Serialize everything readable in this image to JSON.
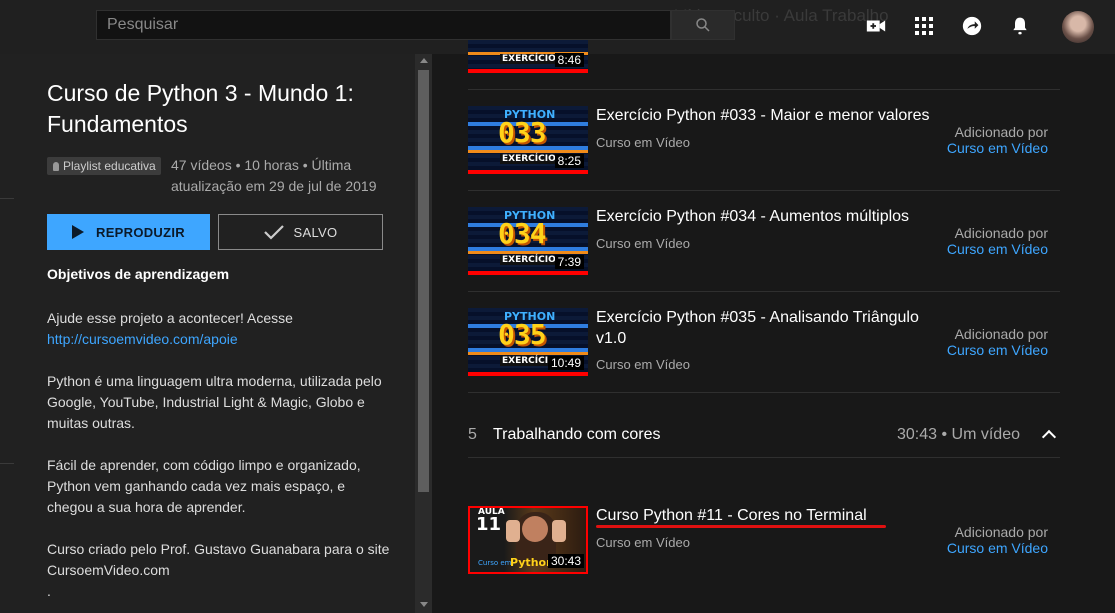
{
  "header": {
    "search_placeholder": "Pesquisar",
    "background_ghost_text": "Vídeo oculto · Aula Trabalho"
  },
  "playlist": {
    "title": "Curso de Python 3 - Mundo 1: Fundamentos",
    "badge": "Playlist educativa",
    "stats": "47 vídeos • 10 horas • Última atualização em 29 de jul de 2019",
    "play_label": "REPRODUZIR",
    "saved_label": "SALVO",
    "objectives_heading": "Objetivos de aprendizagem",
    "desc1_text": "Ajude esse projeto a acontecer! Acesse",
    "desc1_link": "http://cursoemvideo.com/apoie",
    "desc2": "Python é uma linguagem ultra moderna, utilizada pelo Google, YouTube, Industrial Light & Magic, Globo e muitas outras.",
    "desc3": "Fácil de aprender, com código limpo e organizado, Python vem ganhando cada vez mais espaço, e chegou a sua hora de aprender.",
    "desc4": "Curso criado pelo Prof. Gustavo Guanabara para o site CursoemVideo.com",
    "desc5": "."
  },
  "videos": [
    {
      "thumb_label": "EXERCÍCIO",
      "duration": "8:46"
    },
    {
      "title": "Exercício Python #033 - Maior e menor valores",
      "channel": "Curso em Vídeo",
      "thumb_label": "EXERCÍCIO",
      "thumb_python": "PYTHON",
      "thumb_number": "033",
      "duration": "8:25",
      "added_label": "Adicionado por",
      "added_channel": "Curso em Vídeo"
    },
    {
      "title": "Exercício Python #034 - Aumentos múltiplos",
      "channel": "Curso em Vídeo",
      "thumb_label": "EXERCÍCIO",
      "thumb_python": "PYTHON",
      "thumb_number": "034",
      "duration": "7:39",
      "added_label": "Adicionado por",
      "added_channel": "Curso em Vídeo"
    },
    {
      "title": "Exercício Python #035 - Analisando Triângulo v1.0",
      "channel": "Curso em Vídeo",
      "thumb_label": "EXERCÍCIO",
      "thumb_python": "PYTHON",
      "thumb_number": "035",
      "duration": "10:49",
      "added_label": "Adicionado por",
      "added_channel": "Curso em Vídeo"
    }
  ],
  "section": {
    "number": "5",
    "title": "Trabalhando com cores",
    "meta": "30:43 • Um vídeo"
  },
  "section_video": {
    "title": "Curso Python #11 - Cores no Terminal",
    "channel": "Curso em Vídeo",
    "thumb_aula": "AULA",
    "thumb_number": "11",
    "thumb_python": "Python",
    "thumb_cev": "Curso em",
    "duration": "30:43",
    "added_label": "Adicionado por",
    "added_channel": "Curso em Vídeo"
  },
  "colors": {
    "accent": "#3ea6ff",
    "highlight_red": "#ff0000",
    "thumb_yellow": "#ffd21a"
  }
}
